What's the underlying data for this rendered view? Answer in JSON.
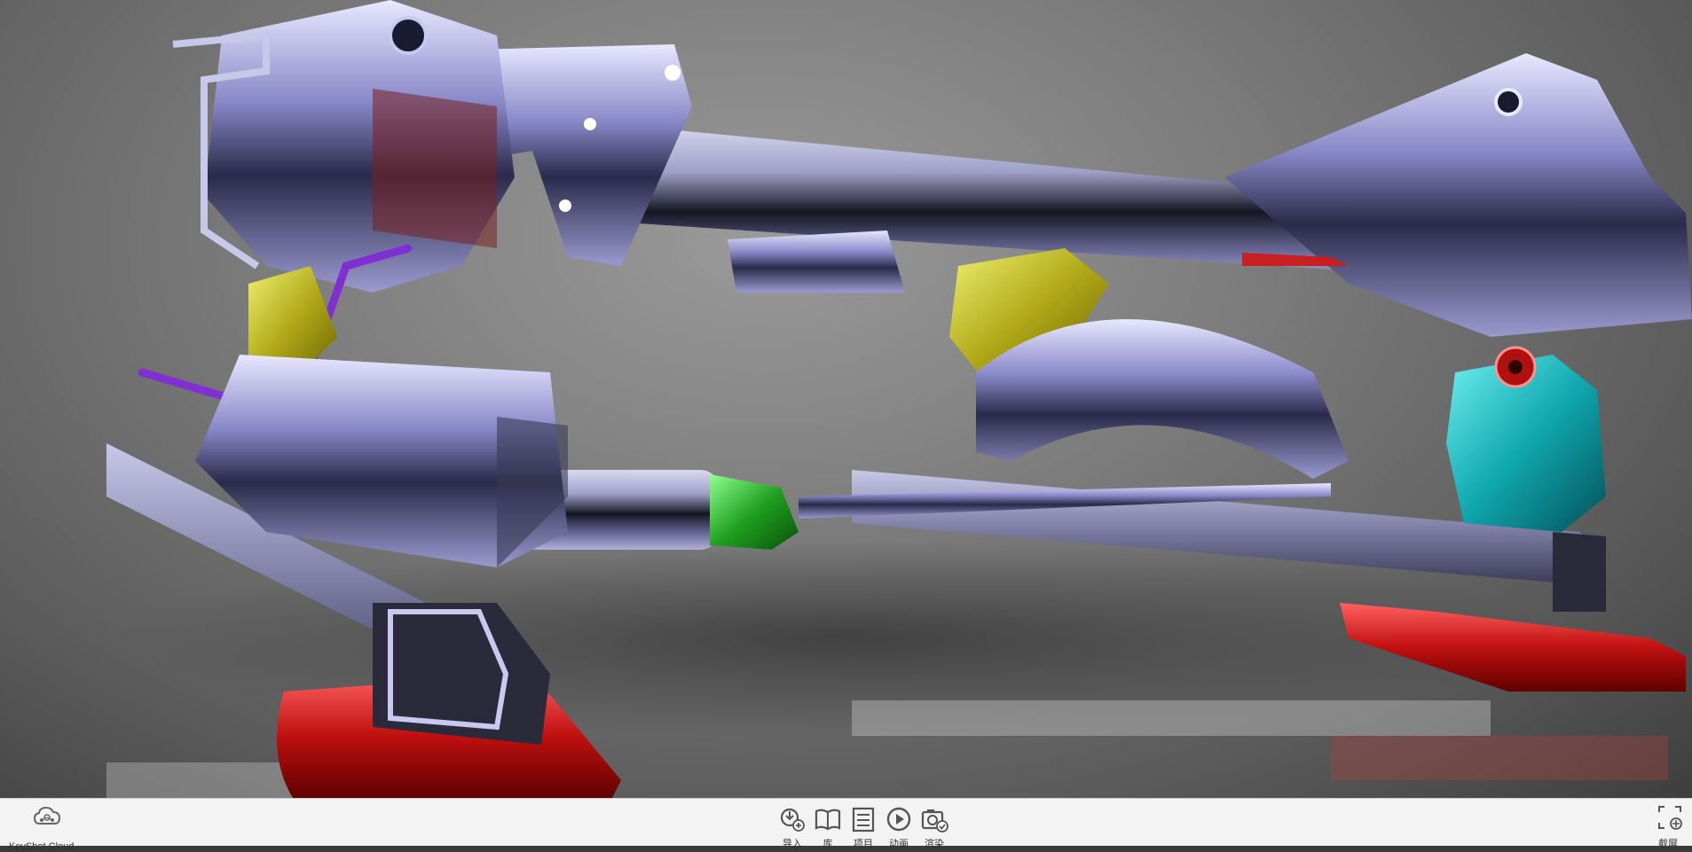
{
  "app": {
    "name": "KeyShot"
  },
  "cloud": {
    "label": "KeyShot Cloud",
    "icon": "cloud-icon"
  },
  "toolbar": {
    "tools": [
      {
        "id": "import",
        "label": "导入",
        "icon": "import-icon"
      },
      {
        "id": "library",
        "label": "库",
        "icon": "library-icon"
      },
      {
        "id": "project",
        "label": "项目",
        "icon": "project-icon"
      },
      {
        "id": "animation",
        "label": "动画",
        "icon": "animation-icon"
      },
      {
        "id": "render",
        "label": "渲染",
        "icon": "render-icon"
      }
    ],
    "screenshot": {
      "label": "截屏",
      "icon": "screenshot-icon"
    }
  },
  "scene": {
    "description_icon": "3d-model-viewport",
    "colors": {
      "chrome": "#b8b8e0",
      "red_part": "#c21414",
      "yellow_part": "#c8c020",
      "teal_part": "#18b8c0",
      "green_part": "#20b020",
      "purple_rod": "#7a30c8"
    }
  }
}
